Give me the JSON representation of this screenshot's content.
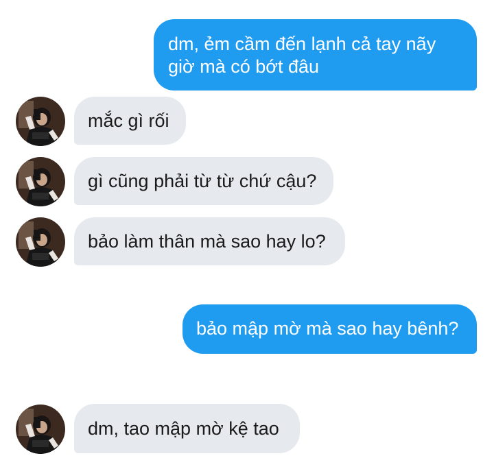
{
  "conversation": {
    "messages": [
      {
        "sender": "me",
        "text": "dm, ẻm cầm đến lạnh cả tay nãy\ngiờ mà có bớt đâu"
      },
      {
        "sender": "other",
        "text": "mắc gì rối"
      },
      {
        "sender": "other",
        "text": "gì cũng phải từ từ chứ cậu?"
      },
      {
        "sender": "other",
        "text": "bảo làm thân mà sao hay lo?"
      },
      {
        "sender": "me",
        "text": "bảo mập mờ mà sao hay bênh?"
      },
      {
        "sender": "other",
        "text": "dm, tao mập mờ kệ tao"
      }
    ]
  },
  "contact": {
    "avatar_icon": "user-photo-avatar"
  },
  "colors": {
    "outgoing_bubble": "#1f9bf0",
    "incoming_bubble": "#e6e9ee",
    "incoming_text": "#1b1b1b",
    "background": "#ffffff"
  }
}
